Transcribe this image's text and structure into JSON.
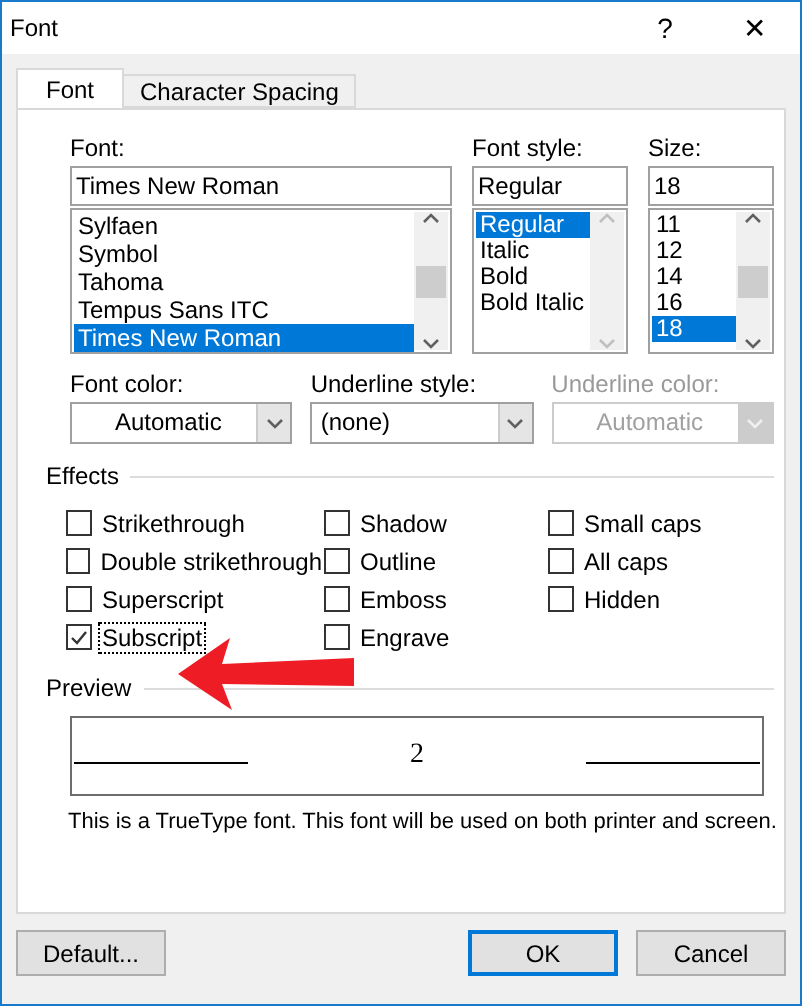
{
  "window": {
    "title": "Font",
    "help": "?",
    "close": "✕"
  },
  "tabs": [
    {
      "label": "Font",
      "selected": true
    },
    {
      "label": "Character Spacing",
      "selected": false
    }
  ],
  "font": {
    "label": "Font:",
    "value": "Times New Roman",
    "items": [
      {
        "label": "Sylfaen",
        "selected": false
      },
      {
        "label": "Symbol",
        "selected": false
      },
      {
        "label": "Tahoma",
        "selected": false
      },
      {
        "label": "Tempus Sans ITC",
        "selected": false
      },
      {
        "label": "Times New Roman",
        "selected": true
      }
    ]
  },
  "font_style": {
    "label": "Font style:",
    "value": "Regular",
    "items": [
      {
        "label": "Regular",
        "selected": true
      },
      {
        "label": "Italic",
        "selected": false
      },
      {
        "label": "Bold",
        "selected": false
      },
      {
        "label": "Bold Italic",
        "selected": false
      }
    ]
  },
  "size": {
    "label": "Size:",
    "value": "18",
    "items": [
      {
        "label": "11",
        "selected": false
      },
      {
        "label": "12",
        "selected": false
      },
      {
        "label": "14",
        "selected": false
      },
      {
        "label": "16",
        "selected": false
      },
      {
        "label": "18",
        "selected": true
      }
    ]
  },
  "dropdowns": [
    {
      "label": "Font color:",
      "value": "Automatic",
      "disabled": false
    },
    {
      "label": "Underline style:",
      "value": "(none)",
      "disabled": false
    },
    {
      "label": "Underline color:",
      "value": "Automatic",
      "disabled": true
    }
  ],
  "effects": {
    "title": "Effects",
    "items": [
      {
        "label": "Strikethrough",
        "checked": false
      },
      {
        "label": "Double strikethrough",
        "checked": false
      },
      {
        "label": "Superscript",
        "checked": false
      },
      {
        "label": "Subscript",
        "checked": true
      },
      {
        "label": "Shadow",
        "checked": false
      },
      {
        "label": "Outline",
        "checked": false
      },
      {
        "label": "Emboss",
        "checked": false
      },
      {
        "label": "Engrave",
        "checked": false
      },
      {
        "label": "Small caps",
        "checked": false
      },
      {
        "label": "All caps",
        "checked": false
      },
      {
        "label": "Hidden",
        "checked": false
      }
    ]
  },
  "preview": {
    "title": "Preview",
    "sample": "2",
    "note": "This is a TrueType font. This font will be used on both printer and screen."
  },
  "buttons": [
    {
      "label": "Default...",
      "default": false
    },
    {
      "label": "OK",
      "default": true
    },
    {
      "label": "Cancel",
      "default": false
    }
  ]
}
